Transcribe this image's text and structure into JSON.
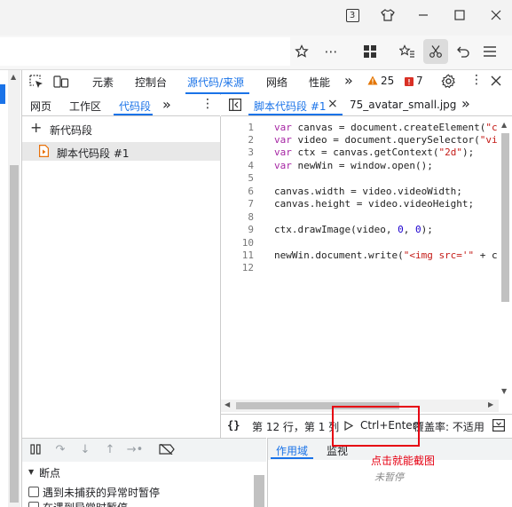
{
  "titlebar": {
    "tab_count": "3",
    "icons": [
      "tab-count-icon",
      "shirt-icon",
      "minimize-icon",
      "maximize-icon",
      "close-icon"
    ]
  },
  "addressbar": {
    "icons": [
      "star-icon",
      "more-icon",
      "apps-grid-icon",
      "favorites-icon",
      "scissors-icon",
      "undo-icon",
      "menu-icon"
    ]
  },
  "devtools": {
    "tabs": [
      {
        "label": "元素"
      },
      {
        "label": "控制台"
      },
      {
        "label": "源代码/来源"
      },
      {
        "label": "网络"
      },
      {
        "label": "性能"
      }
    ],
    "more": "»",
    "warnings_count": "25",
    "issues_count": "7",
    "navigator_tabs": [
      {
        "label": "网页"
      },
      {
        "label": "工作区"
      },
      {
        "label": "代码段"
      }
    ],
    "new_snippet_label": "新代码段",
    "snippet_name": "脚本代码段 #1",
    "editor_tabs": [
      {
        "label": "脚本代码段 #1"
      },
      {
        "label": "75_avatar_small.jpg"
      }
    ],
    "code_lines": [
      {
        "n": "1"
      },
      {
        "n": "2"
      },
      {
        "n": "3"
      },
      {
        "n": "4"
      },
      {
        "n": "5"
      },
      {
        "n": "6"
      },
      {
        "n": "7"
      },
      {
        "n": "8"
      },
      {
        "n": "9"
      },
      {
        "n": "10"
      },
      {
        "n": "11"
      },
      {
        "n": "12"
      }
    ],
    "code": {
      "l1a": "var",
      "l1b": " canvas = document.createElement(",
      "l1c": "\"c",
      "l2a": "var",
      "l2b": " video = document.querySelector(",
      "l2c": "\"vi",
      "l3a": "var",
      "l3b": " ctx = canvas.getContext(",
      "l3c": "\"2d\"",
      "l3d": ");",
      "l4a": "var",
      "l4b": " newWin = window.open();",
      "l6": "canvas.width = video.videoWidth;",
      "l7": "canvas.height = video.videoHeight;",
      "l9a": "ctx.drawImage(video, ",
      "l9b": "0",
      "l9c": ", ",
      "l9d": "0",
      "l9e": ");",
      "l11a": "newWin.document.write(",
      "l11b": "\"<img src='\"",
      "l11c": " + c"
    },
    "status": {
      "braces": "{}",
      "position": "第 12 行，第 1 列",
      "run_shortcut": "Ctrl+Enter",
      "coverage": "覆盖率: 不适用"
    },
    "debugger": {
      "breakpoints_header": "断点",
      "bp_option_1": "遇到未捕获的异常时暂停",
      "bp_option_2": "在遇到异常时暂停"
    },
    "scope_tabs": [
      {
        "label": "作用域"
      },
      {
        "label": "监视"
      }
    ],
    "not_paused": "未暂停"
  },
  "annotation": {
    "text": "点击就能截图",
    "color": "#e60012"
  },
  "colors": {
    "accent": "#1a73e8",
    "warning": "#e37400",
    "issue": "#d93025"
  }
}
